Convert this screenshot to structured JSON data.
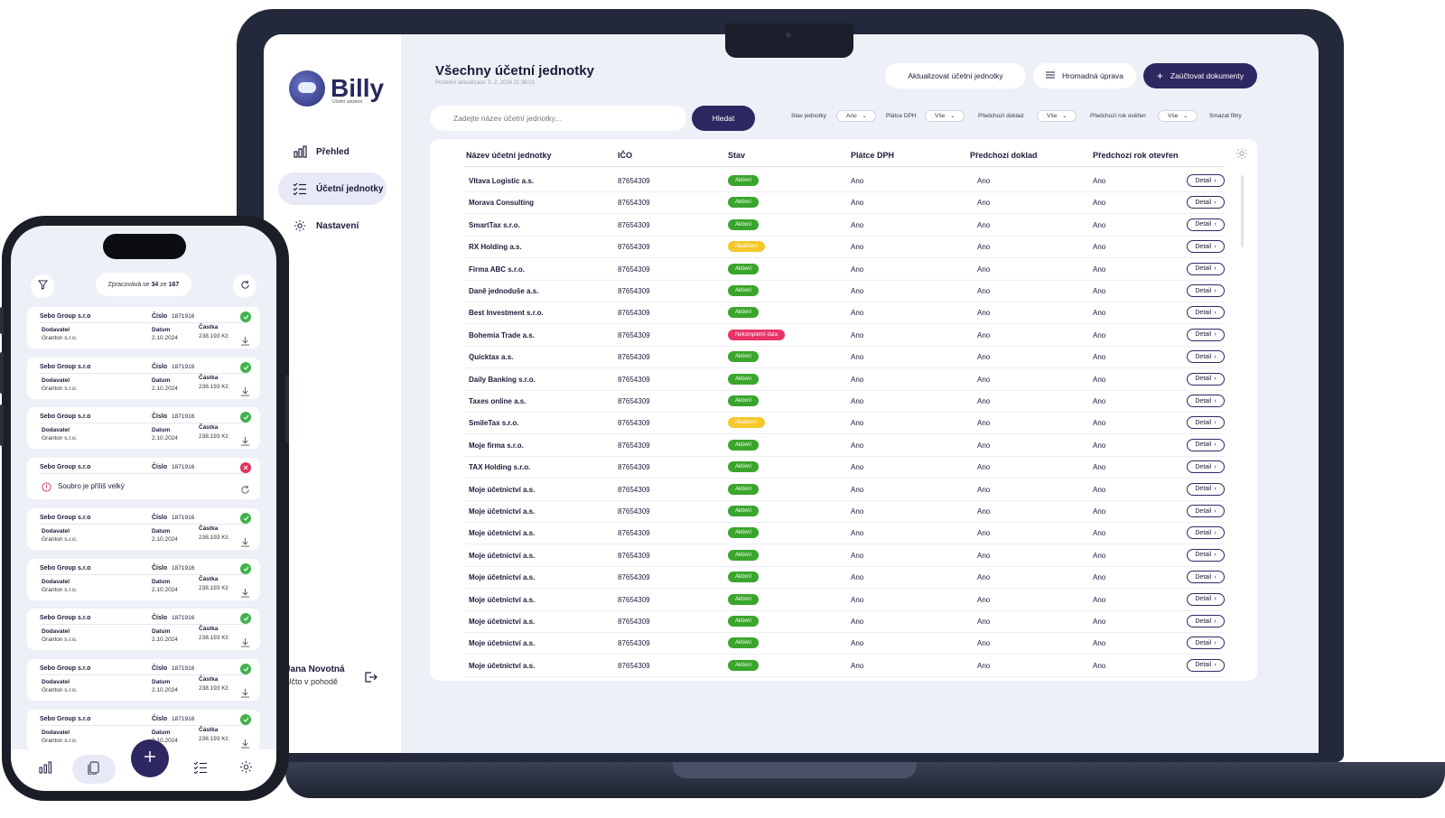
{
  "app": {
    "logo_text": "Billy",
    "logo_sub": "Účetní asistent"
  },
  "sidebar": {
    "items": [
      {
        "label": "Přehled",
        "icon": "bar-chart-icon"
      },
      {
        "label": "Účetní jednotky",
        "icon": "checklist-icon",
        "active": true
      },
      {
        "label": "Nastavení",
        "icon": "gear-icon"
      }
    ],
    "user": {
      "name": "Jana Novotná",
      "role": "Účto v pohodě"
    }
  },
  "header": {
    "title": "Všechny účetní jednotky",
    "subtitle": "Poslední aktualizace: 9. 2. 2026 21:36:01",
    "update_label": "Aktualizovat účetní jednotky",
    "bulk_label": "Hromadná úprava",
    "post_label": "Zaúčtovat dokumenty"
  },
  "search": {
    "placeholder": "Zadejte název účetní jednotky...",
    "button": "Hledat"
  },
  "filters": [
    {
      "label": "Stav jednotky",
      "value": "Ano"
    },
    {
      "label": "Plátce DPH",
      "value": "Vše"
    },
    {
      "label": "Předchozí doklad",
      "value": "Vše"
    },
    {
      "label": "Předchozí rok ověřen",
      "value": "Vše"
    }
  ],
  "clear_filters": "Smazat filtry",
  "table": {
    "columns": [
      "Název účetní jednotky",
      "IČO",
      "Stav",
      "Plátce DPH",
      "Předchozí doklad",
      "Předchozí rok otevřen"
    ],
    "detail_label": "Detail",
    "status_colors": {
      "Aktivní": "#3aa52c",
      "Neaktivní": "#f4c82c",
      "Nekompletní data": "#e83466"
    },
    "rows": [
      {
        "name": "Vltava Logistic a.s.",
        "ico": "87654309",
        "status": "Aktivní",
        "dph": "Ano",
        "doklad": "Ano",
        "rok": "Ano"
      },
      {
        "name": "Morava Consulting",
        "ico": "87654309",
        "status": "Aktivní",
        "dph": "Ano",
        "doklad": "Ano",
        "rok": "Ano"
      },
      {
        "name": "SmartTax s.r.o.",
        "ico": "87654309",
        "status": "Aktivní",
        "dph": "Ano",
        "doklad": "Ano",
        "rok": "Ano"
      },
      {
        "name": "RX Holding a.s.",
        "ico": "87654309",
        "status": "Neaktivní",
        "dph": "Ano",
        "doklad": "Ano",
        "rok": "Ano"
      },
      {
        "name": "Firma ABC s.r.o.",
        "ico": "87654309",
        "status": "Aktivní",
        "dph": "Ano",
        "doklad": "Ano",
        "rok": "Ano"
      },
      {
        "name": "Daně jednoduše a.s.",
        "ico": "87654309",
        "status": "Aktivní",
        "dph": "Ano",
        "doklad": "Ano",
        "rok": "Ano"
      },
      {
        "name": "Best Investment s.r.o.",
        "ico": "87654309",
        "status": "Aktivní",
        "dph": "Ano",
        "doklad": "Ano",
        "rok": "Ano"
      },
      {
        "name": "Bohemia Trade a.s.",
        "ico": "87654309",
        "status": "Nekompletní data",
        "dph": "Ano",
        "doklad": "Ano",
        "rok": "Ano"
      },
      {
        "name": "Quicktax a.s.",
        "ico": "87654309",
        "status": "Aktivní",
        "dph": "Ano",
        "doklad": "Ano",
        "rok": "Ano"
      },
      {
        "name": "Daily Banking s.r.o.",
        "ico": "87654309",
        "status": "Aktivní",
        "dph": "Ano",
        "doklad": "Ano",
        "rok": "Ano"
      },
      {
        "name": "Taxes online a.s.",
        "ico": "87654309",
        "status": "Aktivní",
        "dph": "Ano",
        "doklad": "Ano",
        "rok": "Ano"
      },
      {
        "name": "SmileTax s.r.o.",
        "ico": "87654309",
        "status": "Neaktivní",
        "dph": "Ano",
        "doklad": "Ano",
        "rok": "Ano"
      },
      {
        "name": "Moje firma s.r.o.",
        "ico": "87654309",
        "status": "Aktivní",
        "dph": "Ano",
        "doklad": "Ano",
        "rok": "Ano"
      },
      {
        "name": "TAX Holding s.r.o.",
        "ico": "87654309",
        "status": "Aktivní",
        "dph": "Ano",
        "doklad": "Ano",
        "rok": "Ano"
      },
      {
        "name": "Moje účetnictví a.s.",
        "ico": "87654309",
        "status": "Aktivní",
        "dph": "Ano",
        "doklad": "Ano",
        "rok": "Ano"
      },
      {
        "name": "Moje účetnictví a.s.",
        "ico": "87654309",
        "status": "Aktivní",
        "dph": "Ano",
        "doklad": "Ano",
        "rok": "Ano"
      },
      {
        "name": "Moje účetnictví a.s.",
        "ico": "87654309",
        "status": "Aktivní",
        "dph": "Ano",
        "doklad": "Ano",
        "rok": "Ano"
      },
      {
        "name": "Moje účetnictví a.s.",
        "ico": "87654309",
        "status": "Aktivní",
        "dph": "Ano",
        "doklad": "Ano",
        "rok": "Ano"
      },
      {
        "name": "Moje účetnictví a.s.",
        "ico": "87654309",
        "status": "Aktivní",
        "dph": "Ano",
        "doklad": "Ano",
        "rok": "Ano"
      },
      {
        "name": "Moje účetnictví a.s.",
        "ico": "87654309",
        "status": "Aktivní",
        "dph": "Ano",
        "doklad": "Ano",
        "rok": "Ano"
      },
      {
        "name": "Moje účetnictví a.s.",
        "ico": "87654309",
        "status": "Aktivní",
        "dph": "Ano",
        "doklad": "Ano",
        "rok": "Ano"
      },
      {
        "name": "Moje účetnictví a.s.",
        "ico": "87654309",
        "status": "Aktivní",
        "dph": "Ano",
        "doklad": "Ano",
        "rok": "Ano"
      },
      {
        "name": "Moje účetnictví a.s.",
        "ico": "87654309",
        "status": "Aktivní",
        "dph": "Ano",
        "doklad": "Ano",
        "rok": "Ano"
      }
    ]
  },
  "phone": {
    "progress": {
      "prefix": "Zpracovává se",
      "done": "34",
      "mid": "ze",
      "total": "167"
    },
    "labels": {
      "number": "Číslo",
      "supplier": "Dodavatel",
      "date": "Datum",
      "amount": "Částka"
    },
    "cards": [
      {
        "company": "Sebo Group s.r.o",
        "number": "1871916",
        "supplier": "Granton s.r.o.",
        "date": "2.10.2024",
        "amount": "238.193 Kč",
        "status": "ok"
      },
      {
        "company": "Sebo Group s.r.o",
        "number": "1871916",
        "supplier": "Granton s.r.o.",
        "date": "2.10.2024",
        "amount": "238.193 Kč",
        "status": "ok"
      },
      {
        "company": "Sebo Group s.r.o",
        "number": "1871916",
        "supplier": "Granton s.r.o.",
        "date": "2.10.2024",
        "amount": "238.193 Kč",
        "status": "ok"
      },
      {
        "company": "Sebo Group s.r.o",
        "number": "1871916",
        "error": "Soubro je příliš velký",
        "status": "error"
      },
      {
        "company": "Sebo Group s.r.o",
        "number": "1871916",
        "supplier": "Granton s.r.o.",
        "date": "2.10.2024",
        "amount": "238.193 Kč",
        "status": "ok"
      },
      {
        "company": "Sebo Group s.r.o",
        "number": "1871916",
        "supplier": "Granton s.r.o.",
        "date": "2.10.2024",
        "amount": "238.193 Kč",
        "status": "ok"
      },
      {
        "company": "Sebo Group s.r.o",
        "number": "1871916",
        "supplier": "Granton s.r.o.",
        "date": "2.10.2024",
        "amount": "238.193 Kč",
        "status": "ok"
      },
      {
        "company": "Sebo Group s.r.o",
        "number": "1871916",
        "supplier": "Granton s.r.o.",
        "date": "2.10.2024",
        "amount": "238.193 Kč",
        "status": "ok"
      },
      {
        "company": "Sebo Group s.r.o",
        "number": "1871916",
        "supplier": "Granton s.r.o.",
        "date": "2.10.2024",
        "amount": "238.193 Kč",
        "status": "ok"
      }
    ],
    "tabs": [
      "bar-chart-icon",
      "documents-icon",
      "checklist-icon",
      "gear-icon"
    ]
  }
}
